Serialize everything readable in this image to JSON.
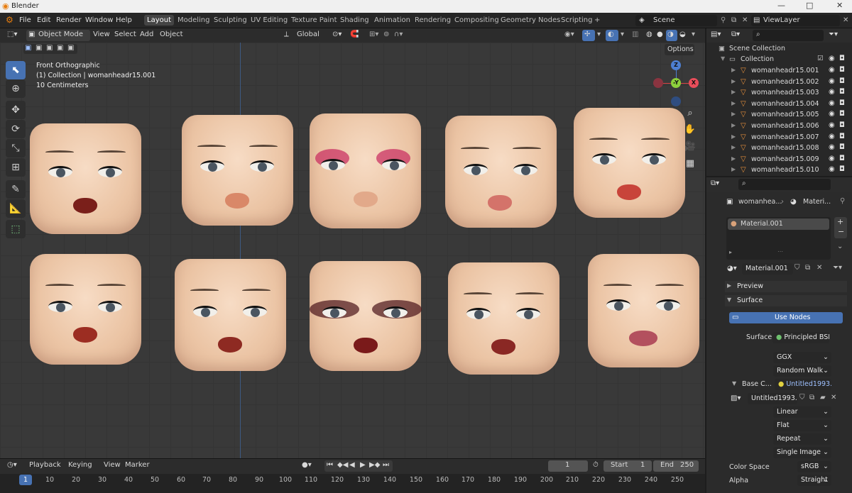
{
  "window": {
    "title": "Blender",
    "minimize": "—",
    "maximize": "□",
    "close": "✕"
  },
  "menu": [
    "File",
    "Edit",
    "Render",
    "Window",
    "Help"
  ],
  "workspaces": [
    "Layout",
    "Modeling",
    "Sculpting",
    "UV Editing",
    "Texture Paint",
    "Shading",
    "Animation",
    "Rendering",
    "Compositing",
    "Geometry Nodes",
    "Scripting"
  ],
  "add_tab": "+",
  "scene": {
    "label": "Scene",
    "viewlayer": "ViewLayer"
  },
  "viewport_header": {
    "mode": "Object Mode",
    "menus": [
      "View",
      "Select",
      "Add",
      "Object"
    ],
    "transform": "Global",
    "options": "Options"
  },
  "overlay": {
    "view": "Front Orthographic",
    "collection": "(1) Collection | womanheadr15.001",
    "scale": "10 Centimeters"
  },
  "gizmo": {
    "z": "Z",
    "y": "-Y",
    "x": "X"
  },
  "timeline": {
    "menus": [
      "Playback",
      "Keying",
      "View",
      "Marker"
    ],
    "current_frame": "1",
    "start_label": "Start",
    "start": "1",
    "end_label": "End",
    "end": "250"
  },
  "frame_ticks": [
    "1",
    "10",
    "20",
    "30",
    "40",
    "50",
    "60",
    "70",
    "80",
    "90",
    "100",
    "110",
    "120",
    "130",
    "140",
    "150",
    "160",
    "170",
    "180",
    "190",
    "200",
    "210",
    "220",
    "230",
    "240",
    "250"
  ],
  "outliner": {
    "scene_collection": "Scene Collection",
    "collection": "Collection",
    "items": [
      "womanheadr15.001",
      "womanheadr15.002",
      "womanheadr15.003",
      "womanheadr15.004",
      "womanheadr15.005",
      "womanheadr15.006",
      "womanheadr15.007",
      "womanheadr15.008",
      "womanheadr15.009",
      "womanheadr15.010"
    ]
  },
  "properties": {
    "breadcrumb_obj": "womanhea...",
    "breadcrumb_mat": "Materi...",
    "slot": "Material.001",
    "material_name": "Material.001",
    "preview": "Preview",
    "surface": "Surface",
    "use_nodes": "Use Nodes",
    "surface_label": "Surface",
    "surface_value": "Principled BSDF",
    "distribution": "GGX",
    "subsurface": "Random Walk",
    "base_color_label": "Base C...",
    "base_color_value": "Untitled1993....",
    "image_name": "Untitled1993....",
    "interpolation": "Linear",
    "projection": "Flat",
    "extension": "Repeat",
    "source": "Single Image",
    "color_space_label": "Color Space",
    "color_space": "sRGB",
    "alpha_label": "Alpha",
    "alpha": "Straight"
  }
}
